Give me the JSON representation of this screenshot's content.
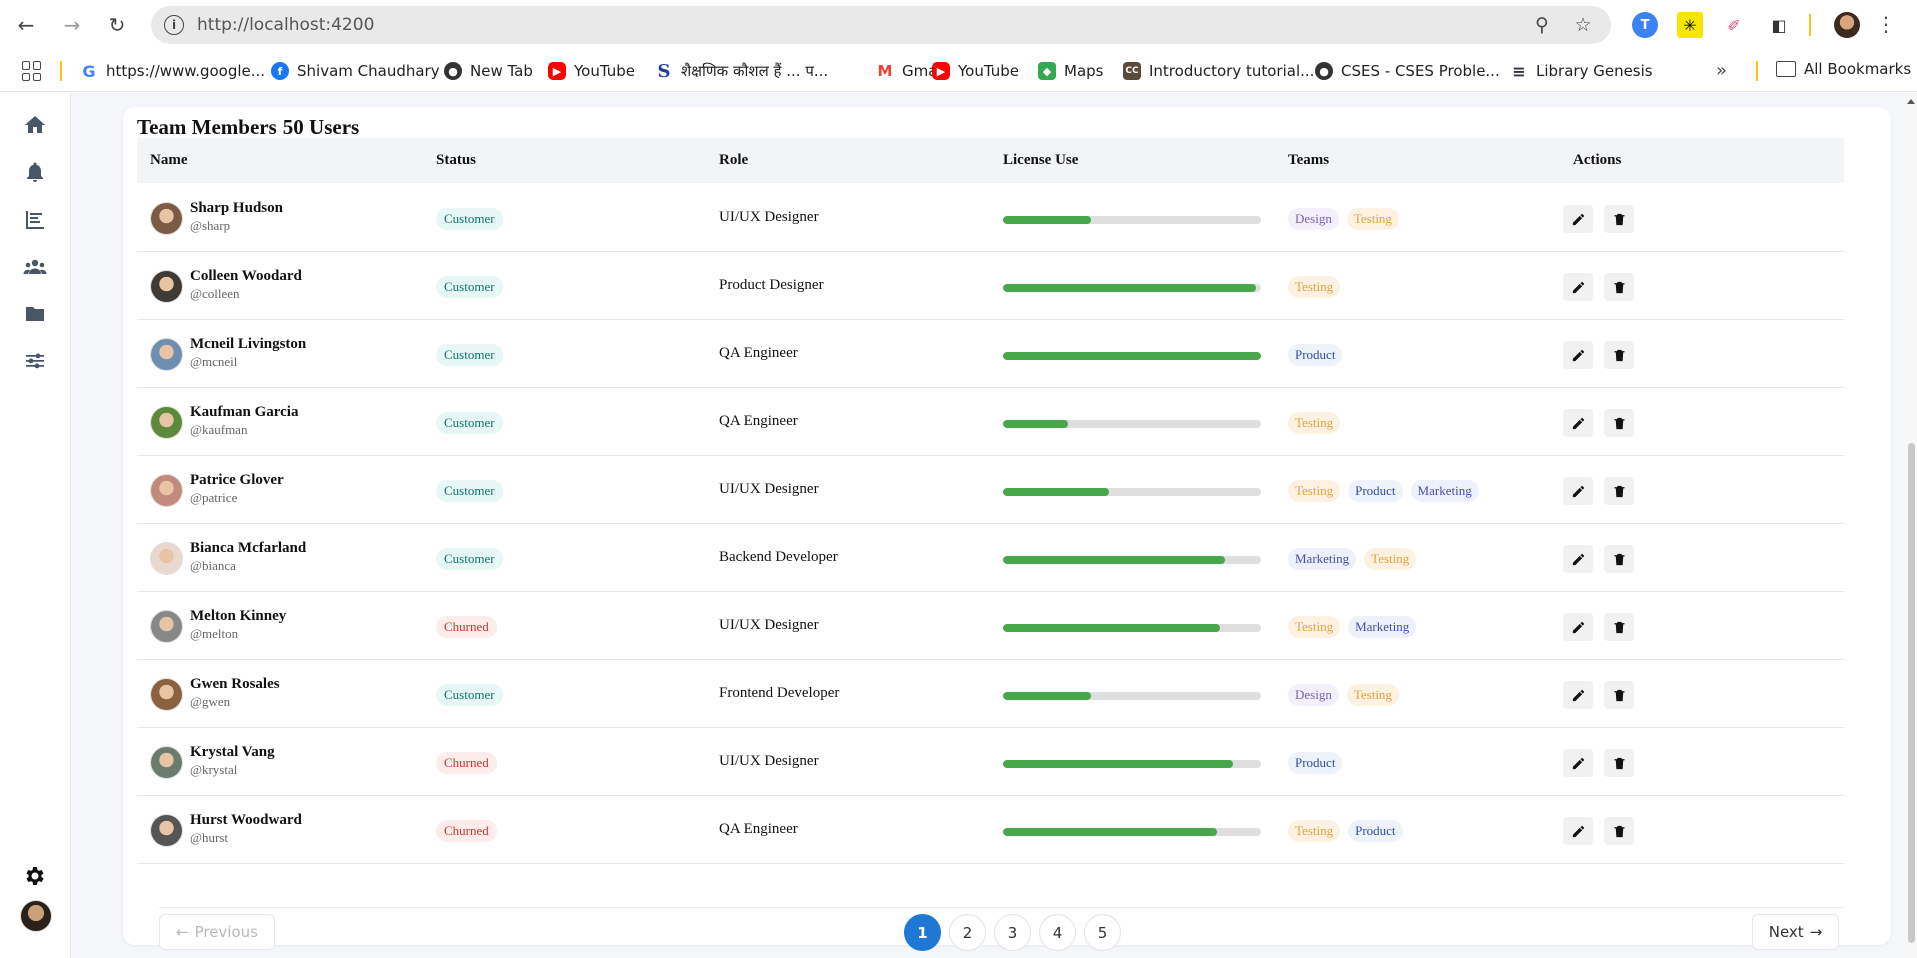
{
  "browser": {
    "url": "http://localhost:4200",
    "bookmarks": [
      {
        "label": "https://www.google...",
        "icon": "google-icon"
      },
      {
        "label": "Shivam Chaudhary",
        "icon": "facebook-icon"
      },
      {
        "label": "New Tab",
        "icon": "globe-icon"
      },
      {
        "label": "YouTube",
        "icon": "youtube-icon"
      },
      {
        "label": "शैक्षणिक कौशल हैं ... प...",
        "icon": "s-logo-icon"
      },
      {
        "label": "Gmail",
        "icon": "gmail-icon"
      },
      {
        "label": "YouTube",
        "icon": "youtube-icon"
      },
      {
        "label": "Maps",
        "icon": "maps-icon"
      },
      {
        "label": "Introductory tutorial...",
        "icon": "cc-icon"
      },
      {
        "label": "CSES - CSES Proble...",
        "icon": "globe-icon"
      },
      {
        "label": "Library Genesis",
        "icon": "libgen-icon"
      }
    ],
    "all_bookmarks": "All Bookmarks",
    "more": "»"
  },
  "page": {
    "title_prefix": "Team Members",
    "title_count": "50 Users"
  },
  "table": {
    "headers": {
      "name": "Name",
      "status": "Status",
      "role": "Role",
      "license": "License Use",
      "teams": "Teams",
      "actions": "Actions"
    },
    "rows": [
      {
        "name": "Sharp Hudson",
        "handle": "@sharp",
        "status": "Customer",
        "role": "UI/UX Designer",
        "license": 0.34,
        "teams": [
          "Design",
          "Testing"
        ]
      },
      {
        "name": "Colleen Woodard",
        "handle": "@colleen",
        "status": "Customer",
        "role": "Product Designer",
        "license": 0.98,
        "teams": [
          "Testing"
        ]
      },
      {
        "name": "Mcneil Livingston",
        "handle": "@mcneil",
        "status": "Customer",
        "role": "QA Engineer",
        "license": 1.0,
        "teams": [
          "Product"
        ]
      },
      {
        "name": "Kaufman Garcia",
        "handle": "@kaufman",
        "status": "Customer",
        "role": "QA Engineer",
        "license": 0.25,
        "teams": [
          "Testing"
        ]
      },
      {
        "name": "Patrice Glover",
        "handle": "@patrice",
        "status": "Customer",
        "role": "UI/UX Designer",
        "license": 0.41,
        "teams": [
          "Testing",
          "Product",
          "Marketing"
        ]
      },
      {
        "name": "Bianca Mcfarland",
        "handle": "@bianca",
        "status": "Customer",
        "role": "Backend Developer",
        "license": 0.86,
        "teams": [
          "Marketing",
          "Testing"
        ]
      },
      {
        "name": "Melton Kinney",
        "handle": "@melton",
        "status": "Churned",
        "role": "UI/UX Designer",
        "license": 0.84,
        "teams": [
          "Testing",
          "Marketing"
        ]
      },
      {
        "name": "Gwen Rosales",
        "handle": "@gwen",
        "status": "Customer",
        "role": "Frontend Developer",
        "license": 0.34,
        "teams": [
          "Design",
          "Testing"
        ]
      },
      {
        "name": "Krystal Vang",
        "handle": "@krystal",
        "status": "Churned",
        "role": "UI/UX Designer",
        "license": 0.89,
        "teams": [
          "Product"
        ]
      },
      {
        "name": "Hurst Woodward",
        "handle": "@hurst",
        "status": "Churned",
        "role": "QA Engineer",
        "license": 0.83,
        "teams": [
          "Testing",
          "Product"
        ]
      }
    ]
  },
  "pagination": {
    "previous": "Previous",
    "next": "Next",
    "pages": [
      "1",
      "2",
      "3",
      "4",
      "5"
    ],
    "current": "1"
  },
  "colors": {
    "accent": "#1e78d4",
    "progress": "#46a84b",
    "customer_bg": "#e6f7f6",
    "churned_bg": "#fdecec"
  }
}
